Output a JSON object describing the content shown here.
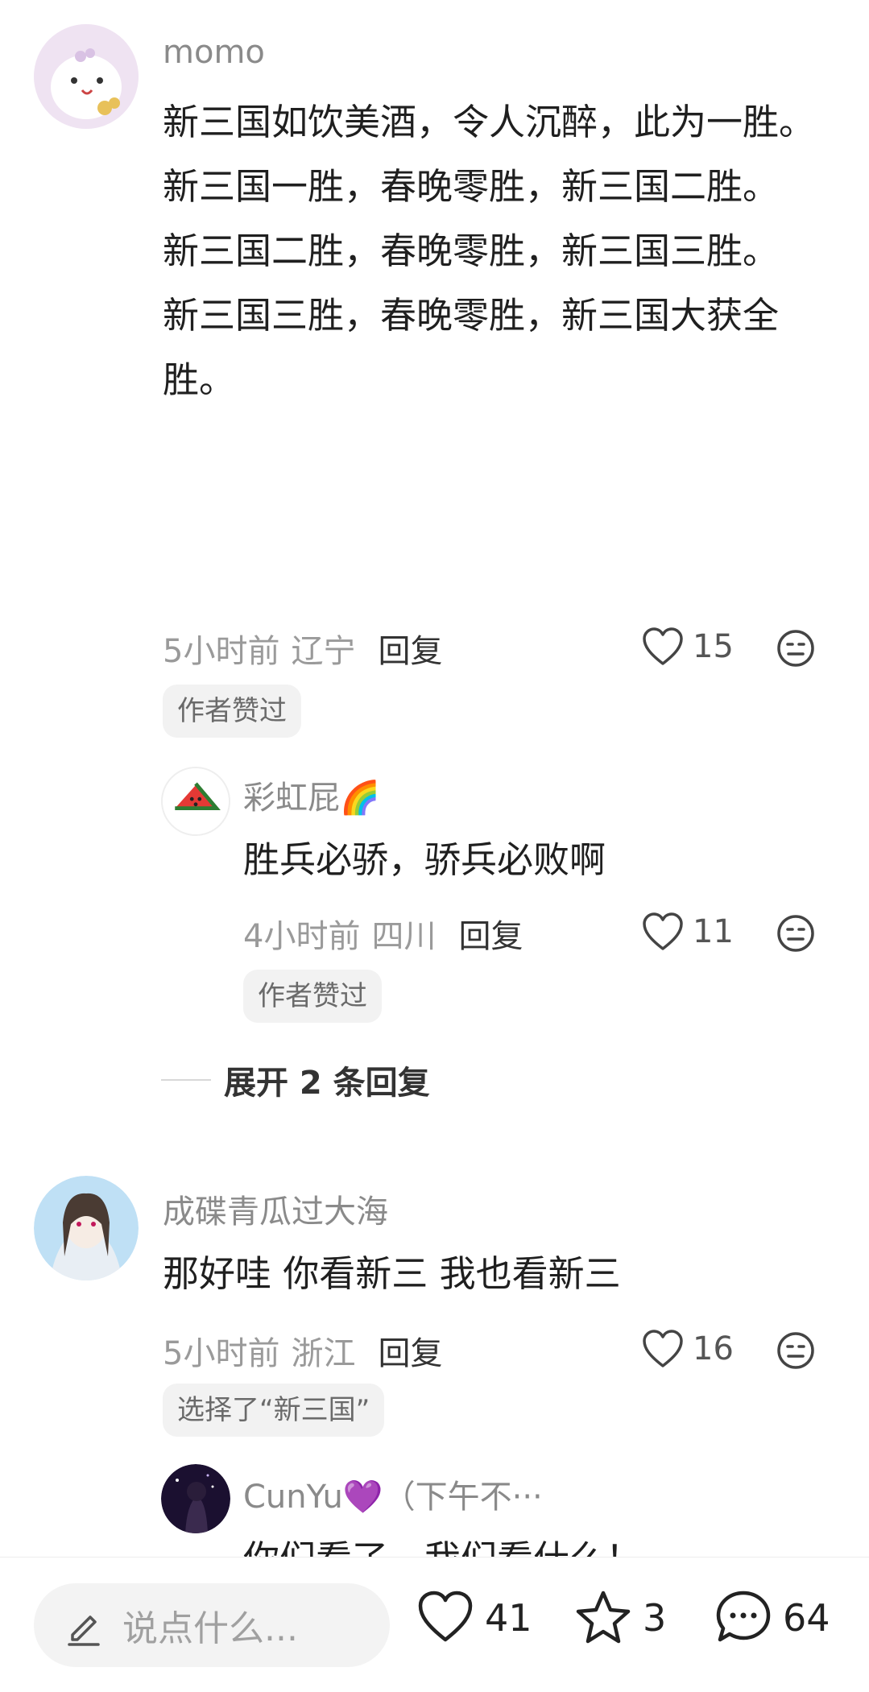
{
  "comments": [
    {
      "username": "momo",
      "paragraphs": [
        "新三国如饮美酒，令人沉醉，此为一胜。",
        "新三国一胜，春晚零胜，新三国二胜。",
        "新三国二胜，春晚零胜，新三国三胜。",
        "新三国三胜，春晚零胜，新三国大获全胜。"
      ],
      "time": "5小时前",
      "location": "辽宁",
      "reply_label": "回复",
      "likes": "15",
      "chip": "作者赞过",
      "replies": [
        {
          "username": "彩虹屁🌈",
          "text": "胜兵必骄，骄兵必败啊",
          "time": "4小时前",
          "location": "四川",
          "reply_label": "回复",
          "likes": "11",
          "chip": "作者赞过"
        }
      ],
      "expand_label": "展开 2 条回复"
    },
    {
      "username": "成碟青瓜过大海",
      "text": "那好哇 你看新三 我也看新三",
      "time": "5小时前",
      "location": "浙江",
      "reply_label": "回复",
      "likes": "16",
      "chip": "选择了“新三国”",
      "replies": [
        {
          "username": "CunYu💜（下午不···",
          "text": "你们看了，我们看什么！"
        }
      ]
    }
  ],
  "bottom_bar": {
    "input_placeholder": "说点什么...",
    "likes": "41",
    "favorites": "3",
    "comments": "64"
  },
  "icons": [
    "edit-icon",
    "heart-icon",
    "star-icon",
    "comment-icon",
    "dislike-face-icon"
  ],
  "colors": {
    "text": "#1f1f1f",
    "meta": "#9a9a9a",
    "chip_bg": "#f2f2f2",
    "username": "#8a8a8a"
  }
}
